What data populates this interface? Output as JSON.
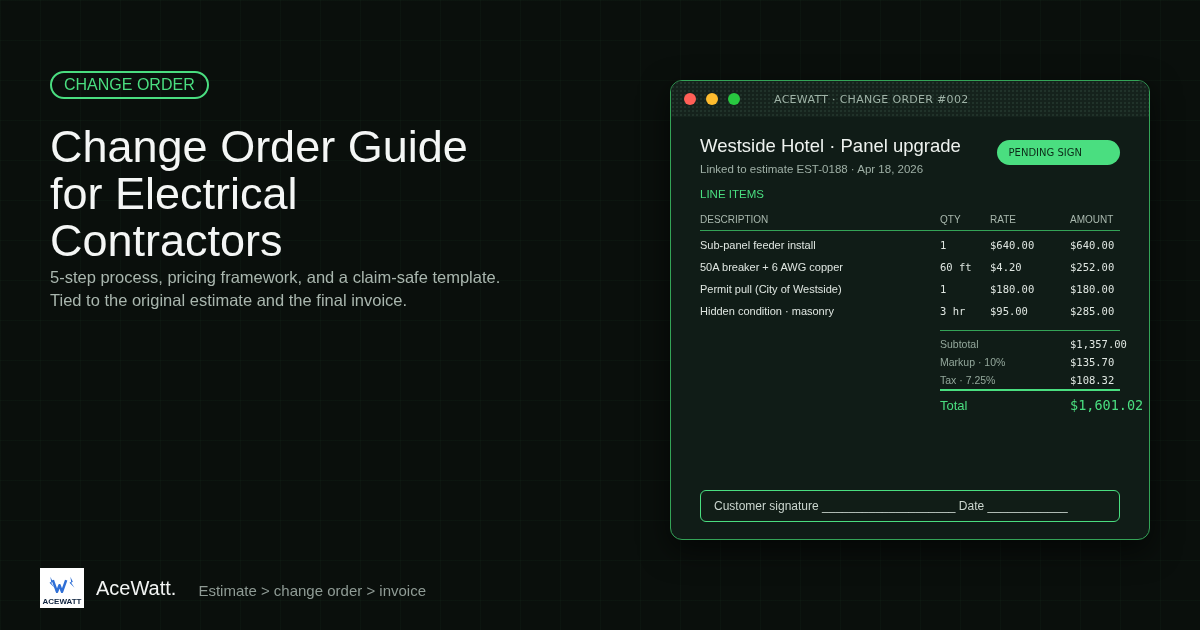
{
  "hero": {
    "tag": "CHANGE ORDER",
    "title": "Change Order Guide for Electrical Contractors",
    "subtitle_lines": [
      "5-step process, pricing framework, and a claim-safe template.",
      "Tied to the original estimate and the final invoice."
    ]
  },
  "footer": {
    "logo_text": "ACEWATT",
    "brand": "AceWatt.",
    "flow": "Estimate > change order > invoice"
  },
  "window": {
    "title": "ACEWATT · CHANGE ORDER #002",
    "heading": "Westside Hotel · Panel upgrade",
    "subheading": "Linked to estimate EST-0188 · Apr 18, 2026",
    "status": "PENDING SIGN",
    "section_label": "LINE ITEMS",
    "table": {
      "columns": [
        "DESCRIPTION",
        "QTY",
        "RATE",
        "AMOUNT"
      ],
      "rows": [
        [
          "Sub-panel feeder install",
          "1",
          "$640.00",
          "$640.00"
        ],
        [
          "50A breaker + 6 AWG copper",
          "60 ft",
          "$4.20",
          "$252.00"
        ],
        [
          "Permit pull (City of Westside)",
          "1",
          "$180.00",
          "$180.00"
        ],
        [
          "Hidden condition · masonry",
          "3 hr",
          "$95.00",
          "$285.00"
        ]
      ]
    },
    "totals": [
      {
        "kind": "line",
        "label": "Subtotal",
        "value": "$1,357.00"
      },
      {
        "kind": "line",
        "label": "Markup · 10%",
        "value": "$135.70"
      },
      {
        "kind": "line",
        "label": "Tax · 7.25%",
        "value": "$108.32"
      },
      {
        "kind": "grand",
        "label": "Total",
        "value": "$1,601.02"
      }
    ],
    "signature": "Customer signature ____________________  Date ____________"
  }
}
